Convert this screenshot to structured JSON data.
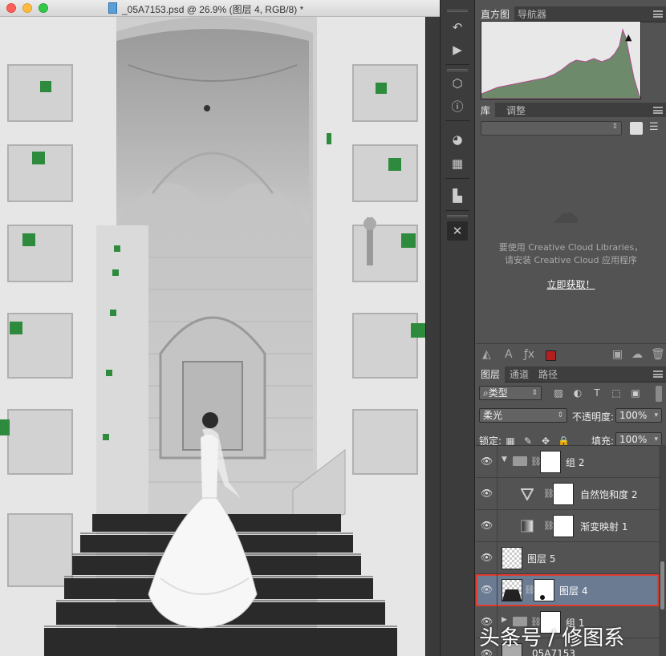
{
  "window": {
    "title": "_05A7153.psd @ 26.9% (图层 4, RGB/8) *"
  },
  "tools": [
    {
      "icon": "history-brush-icon"
    },
    {
      "icon": "play-actions-icon"
    },
    {
      "icon": "3d-cube-icon"
    },
    {
      "icon": "info-icon"
    },
    {
      "icon": "palette-icon"
    },
    {
      "icon": "grid-swatches-icon"
    },
    {
      "icon": "clone-source-icon"
    },
    {
      "icon": "tools-crossed-icon"
    }
  ],
  "histogram_panel": {
    "tabs": [
      "直方图",
      "导航器"
    ],
    "warning": "▲"
  },
  "library_panel": {
    "tabs": [
      "库",
      "调整"
    ],
    "message_line1": "要使用 Creative Cloud Libraries，",
    "message_line2": "请安装 Creative Cloud 应用程序",
    "link": "立即获取！",
    "footer_color": "#b31f1f"
  },
  "layers_panel": {
    "tabs": [
      "图层",
      "通道",
      "路径"
    ],
    "filter_label": "类型",
    "blend_mode": "柔光",
    "opacity_label": "不透明度:",
    "opacity_value": "100%",
    "lock_label": "锁定:",
    "fill_label": "填充:",
    "fill_value": "100%",
    "layers": [
      {
        "name": "组 2",
        "type": "group-open",
        "visible": true,
        "selected": false
      },
      {
        "name": "自然饱和度 2",
        "type": "adjustment-vibrance",
        "visible": true,
        "selected": false
      },
      {
        "name": "渐变映射 1",
        "type": "adjustment-gradient",
        "visible": true,
        "selected": false
      },
      {
        "name": "图层 5",
        "type": "pixel",
        "visible": true,
        "selected": false
      },
      {
        "name": "图层 4",
        "type": "pixel-mask",
        "visible": true,
        "selected": true
      },
      {
        "name": "组 1",
        "type": "group-closed",
        "visible": true,
        "selected": false
      },
      {
        "name": "_05A7153",
        "type": "pixel",
        "visible": true,
        "selected": false
      }
    ]
  },
  "watermark": "头条号 / 修图系"
}
